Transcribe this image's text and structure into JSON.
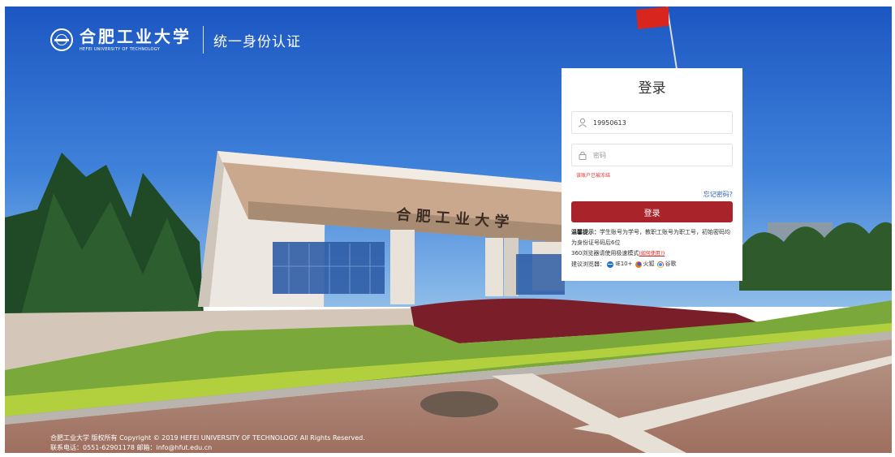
{
  "header": {
    "logo_cn": "合肥工业大学",
    "logo_en": "HEFEI UNIVERSITY OF TECHNOLOGY",
    "system_title": "统一身份认证"
  },
  "background": {
    "gate_inscription": "合 肥 工 业 大 学"
  },
  "login": {
    "title": "登录",
    "username_value": "19950613",
    "password_placeholder": "密码",
    "error_message": "该账户已被冻结",
    "forgot_link": "忘记密码?",
    "submit_label": "登录",
    "tips": {
      "label": "温馨提示：",
      "line1": "学生账号为学号，教职工账号为职工号，初始密码均为身份证号码后6位",
      "line2": "360浏览器请使用极速模式",
      "how_to": "(如何使用?)",
      "browsers_label": "建议浏览器：",
      "browsers": [
        "IE10+",
        "火狐",
        "谷歌"
      ]
    }
  },
  "footer": {
    "copyright": "合肥工业大学 版权所有 Copyright © 2019 HEFEI UNIVERSITY OF TECHNOLOGY. All Rights Reserved.",
    "contact": "联系电话：0551-62901178 邮箱：info@hfut.edu.cn"
  },
  "colors": {
    "button": "#a8232a",
    "link": "#2b63b8",
    "error": "#e0312f",
    "sky": "#2f6fd0"
  },
  "icons": {
    "username": "user-icon",
    "password": "lock-icon",
    "flag": "flag-icon"
  }
}
